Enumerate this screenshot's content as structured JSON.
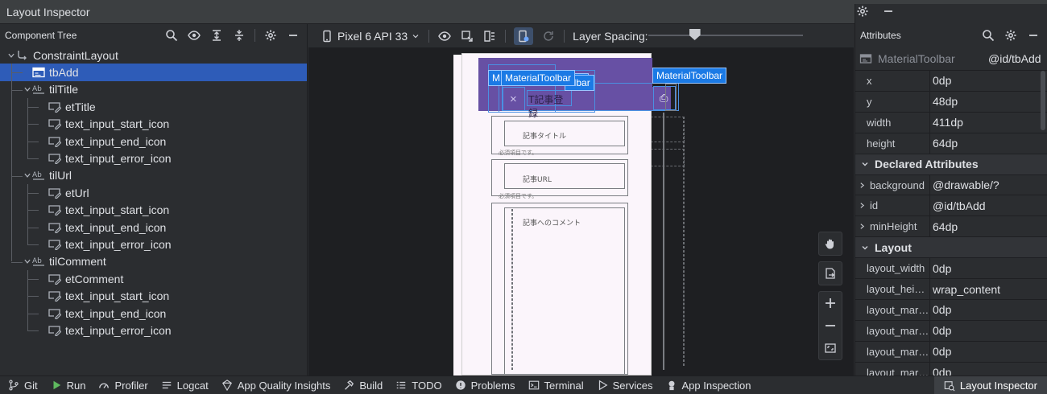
{
  "window": {
    "title": "Layout Inspector"
  },
  "component_tree": {
    "header": "Component Tree",
    "nodes": [
      {
        "label": "ConstraintLayout",
        "depth": 0,
        "icon": "constraint-layout-icon",
        "expanded": true
      },
      {
        "label": "tbAdd",
        "depth": 1,
        "icon": "toolbar-icon",
        "selected": true
      },
      {
        "label": "tilTitle",
        "depth": 1,
        "icon": "text-input-layout-icon",
        "expanded": true
      },
      {
        "label": "etTitle",
        "depth": 2,
        "icon": "edit-text-icon"
      },
      {
        "label": "text_input_start_icon",
        "depth": 2,
        "icon": "edit-text-icon"
      },
      {
        "label": "text_input_end_icon",
        "depth": 2,
        "icon": "edit-text-icon"
      },
      {
        "label": "text_input_error_icon",
        "depth": 2,
        "icon": "edit-text-icon"
      },
      {
        "label": "tilUrl",
        "depth": 1,
        "icon": "text-input-layout-icon",
        "expanded": true
      },
      {
        "label": "etUrl",
        "depth": 2,
        "icon": "edit-text-icon"
      },
      {
        "label": "text_input_start_icon",
        "depth": 2,
        "icon": "edit-text-icon"
      },
      {
        "label": "text_input_end_icon",
        "depth": 2,
        "icon": "edit-text-icon"
      },
      {
        "label": "text_input_error_icon",
        "depth": 2,
        "icon": "edit-text-icon"
      },
      {
        "label": "tilComment",
        "depth": 1,
        "icon": "text-input-layout-icon",
        "expanded": true
      },
      {
        "label": "etComment",
        "depth": 2,
        "icon": "edit-text-icon"
      },
      {
        "label": "text_input_start_icon",
        "depth": 2,
        "icon": "edit-text-icon"
      },
      {
        "label": "text_input_end_icon",
        "depth": 2,
        "icon": "edit-text-icon"
      },
      {
        "label": "text_input_error_icon",
        "depth": 2,
        "icon": "edit-text-icon"
      }
    ]
  },
  "center_toolbar": {
    "device": "Pixel 6 API 33",
    "layer_spacing_label": "Layer Spacing:",
    "layer_spacing_value": 0.3
  },
  "canvas": {
    "labels": {
      "material_toolbar_1": "MaterialToolbar",
      "material_toolbar_2": "MaterialToolbar",
      "material_toolbar_3": "MaterialToolbar",
      "partial_toolbar_a": "M",
      "partial_toolbar_b": "lbar",
      "partial_toolbar_c": "olbar",
      "toolbar_title_partial": "T記事登録",
      "close_glyph": "×",
      "save_glyph": "⎙",
      "hint_title": "記事タイトル",
      "hint_url": "記事URL",
      "hint_comment": "記事へのコメント",
      "error_title": "必須項目です。",
      "error_url": "必須項目です。"
    }
  },
  "attributes": {
    "header": "Attributes",
    "view_class": "MaterialToolbar",
    "view_id": "@id/tbAdd",
    "basic": [
      {
        "name": "x",
        "value": "0dp"
      },
      {
        "name": "y",
        "value": "48dp"
      },
      {
        "name": "width",
        "value": "411dp"
      },
      {
        "name": "height",
        "value": "64dp"
      }
    ],
    "declared_section": "Declared Attributes",
    "declared": [
      {
        "name": "background",
        "value": "@drawable/?"
      },
      {
        "name": "id",
        "value": "@id/tbAdd"
      },
      {
        "name": "minHeight",
        "value": "64dp"
      }
    ],
    "layout_section": "Layout",
    "layout": [
      {
        "name": "layout_width",
        "value": "0dp"
      },
      {
        "name": "layout_hei…",
        "value": "wrap_content"
      },
      {
        "name": "layout_mar…",
        "value": "0dp"
      },
      {
        "name": "layout_mar…",
        "value": "0dp"
      },
      {
        "name": "layout_mar…",
        "value": "0dp"
      },
      {
        "name": "layout_mar…",
        "value": "0dp"
      }
    ]
  },
  "bottom_bar": {
    "items": [
      {
        "label": "Git",
        "icon": "git-branch-icon"
      },
      {
        "label": "Run",
        "icon": "run-icon"
      },
      {
        "label": "Profiler",
        "icon": "profiler-icon"
      },
      {
        "label": "Logcat",
        "icon": "logcat-icon"
      },
      {
        "label": "App Quality Insights",
        "icon": "app-quality-insights-icon"
      },
      {
        "label": "Build",
        "icon": "build-hammer-icon"
      },
      {
        "label": "TODO",
        "icon": "todo-list-icon"
      },
      {
        "label": "Problems",
        "icon": "problems-icon"
      },
      {
        "label": "Terminal",
        "icon": "terminal-icon"
      },
      {
        "label": "Services",
        "icon": "services-icon"
      },
      {
        "label": "App Inspection",
        "icon": "app-inspection-icon"
      }
    ],
    "active": {
      "label": "Layout Inspector",
      "icon": "layout-inspector-icon"
    }
  },
  "colors": {
    "toolbar_purple": "#6750a4",
    "selection_blue": "#2e5cb8",
    "layer_label_blue": "#1b7ae5",
    "run_green": "#5fb95f"
  }
}
